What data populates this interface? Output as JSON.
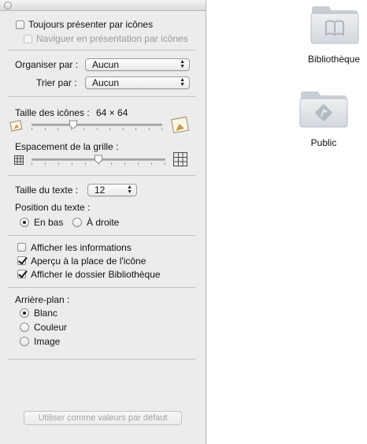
{
  "panel": {
    "toujours_label": "Toujours présenter par icônes",
    "naviguer_label": "Naviguer en présentation par icônes",
    "organiser_label": "Organiser par :",
    "organiser_value": "Aucun",
    "trier_label": "Trier par :",
    "trier_value": "Aucun",
    "taille_icones_label": "Taille des icônes :",
    "taille_icones_value": "64 × 64",
    "taille_icones_level": 0.32,
    "espacement_label": "Espacement de la grille :",
    "espacement_level": 0.5,
    "taille_texte_label": "Taille du texte :",
    "taille_texte_value": "12",
    "position_texte_label": "Position du texte :",
    "position_options": [
      {
        "label": "En bas",
        "selected": true
      },
      {
        "label": "À droite",
        "selected": false
      }
    ],
    "checkboxes": [
      {
        "label": "Afficher les informations",
        "checked": false
      },
      {
        "label": "Aperçu à la place de l'icône",
        "checked": true
      },
      {
        "label": "Afficher le dossier Bibliothèque",
        "checked": true
      }
    ],
    "arriere_plan_label": "Arrière-plan :",
    "background_options": [
      {
        "label": "Blanc",
        "selected": true
      },
      {
        "label": "Couleur",
        "selected": false
      },
      {
        "label": "Image",
        "selected": false
      }
    ],
    "default_button": "Utiliser comme valeurs par défaut"
  },
  "desktop": {
    "folders": [
      {
        "label": "Bibliothèque",
        "icon": "library-folder-icon"
      },
      {
        "label": "Public",
        "icon": "public-folder-icon"
      }
    ]
  },
  "colors": {
    "panel_bg": "#ececec",
    "folder_fill": "#dfe3e8",
    "folder_glyph": "#b9c0c9"
  }
}
